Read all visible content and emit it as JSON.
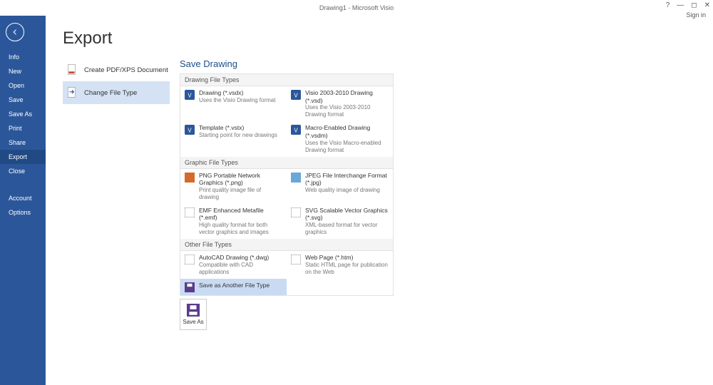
{
  "title": "Drawing1 - Microsoft Visio",
  "signin": "Sign in",
  "window": {
    "help": "?",
    "min": "—",
    "restore": "◻",
    "close": "✕"
  },
  "sidebar": {
    "items": [
      {
        "label": "Info"
      },
      {
        "label": "New"
      },
      {
        "label": "Open"
      },
      {
        "label": "Save"
      },
      {
        "label": "Save As"
      },
      {
        "label": "Print"
      },
      {
        "label": "Share"
      },
      {
        "label": "Export"
      },
      {
        "label": "Close"
      }
    ],
    "bottom": [
      {
        "label": "Account"
      },
      {
        "label": "Options"
      }
    ]
  },
  "page": {
    "heading": "Export",
    "options": [
      {
        "label": "Create PDF/XPS Document",
        "icon": "pdf"
      },
      {
        "label": "Change File Type",
        "icon": "change"
      }
    ]
  },
  "panel": {
    "heading": "Save Drawing",
    "groups": [
      {
        "title": "Drawing File Types",
        "items": [
          {
            "name": "Drawing (*.vsdx)",
            "desc": "Uses the Visio Drawing format",
            "icon": "visio"
          },
          {
            "name": "Visio 2003-2010 Drawing (*.vsd)",
            "desc": "Uses the Visio 2003-2010 Drawing format",
            "icon": "visio"
          },
          {
            "name": "Template (*.vstx)",
            "desc": "Starting point for new drawings",
            "icon": "visio"
          },
          {
            "name": "Macro-Enabled Drawing (*.vsdm)",
            "desc": "Uses the Visio Macro-enabled Drawing format",
            "icon": "visio"
          }
        ]
      },
      {
        "title": "Graphic File Types",
        "items": [
          {
            "name": "PNG Portable Network Graphics (*.png)",
            "desc": "Print quality image file of drawing",
            "icon": "png"
          },
          {
            "name": "JPEG File Interchange Format (*.jpg)",
            "desc": "Web quality image of drawing",
            "icon": "jpg"
          },
          {
            "name": "EMF Enhanced Metafile (*.emf)",
            "desc": "High quality format for both vector graphics and images",
            "icon": "emf"
          },
          {
            "name": "SVG Scalable Vector Graphics (*.svg)",
            "desc": "XML-based format for vector graphics",
            "icon": "svg"
          }
        ]
      },
      {
        "title": "Other File Types",
        "items": [
          {
            "name": "AutoCAD Drawing (*.dwg)",
            "desc": "Compatible with CAD applications",
            "icon": "dwg"
          },
          {
            "name": "Web Page (*.htm)",
            "desc": "Static HTML page for publication on the Web",
            "icon": "htm"
          },
          {
            "name": "Save as Another File Type",
            "desc": "",
            "icon": "save",
            "selected": true
          }
        ]
      }
    ],
    "saveas_label": "Save As"
  }
}
